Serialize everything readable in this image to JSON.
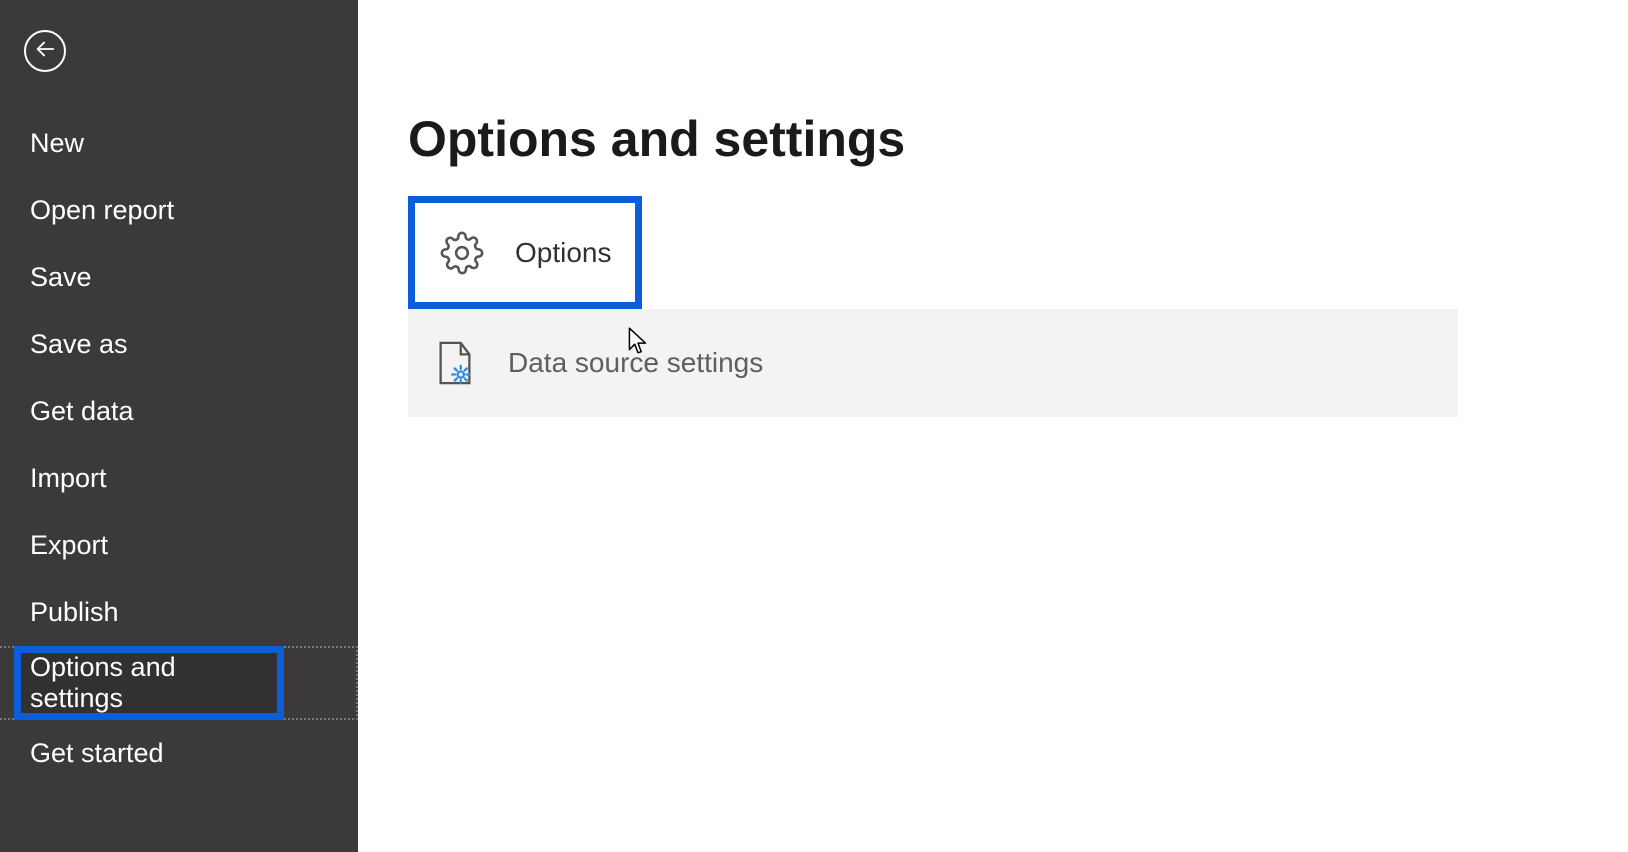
{
  "sidebar": {
    "items": [
      {
        "label": "New"
      },
      {
        "label": "Open report"
      },
      {
        "label": "Save"
      },
      {
        "label": "Save as"
      },
      {
        "label": "Get data"
      },
      {
        "label": "Import"
      },
      {
        "label": "Export"
      },
      {
        "label": "Publish"
      },
      {
        "label": "Options and settings"
      },
      {
        "label": "Get started"
      }
    ]
  },
  "main": {
    "title": "Options and settings",
    "options_label": "Options",
    "dss_label": "Data source settings"
  }
}
